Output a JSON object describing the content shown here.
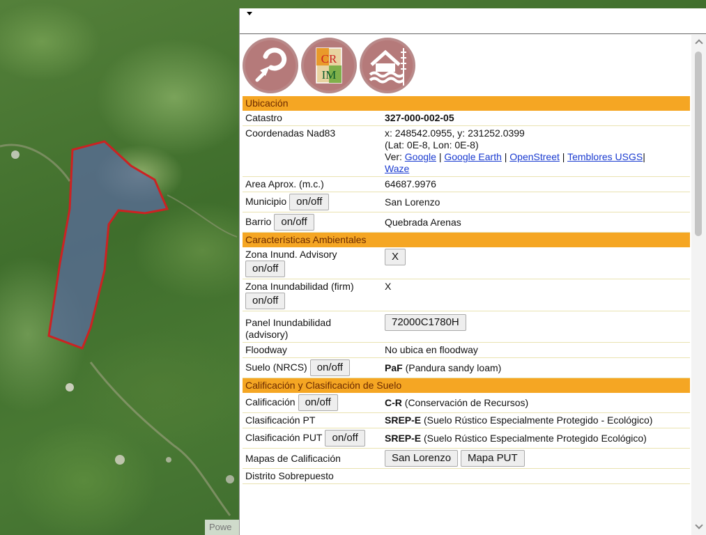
{
  "map": {
    "attribution": "Powe",
    "parcel_outline_color": "#cc2222",
    "parcel_fill_color": "#5a6b9c"
  },
  "logos": [
    {
      "name": "arrow-logo"
    },
    {
      "name": "crim-logo",
      "text_top": "CR",
      "text_bottom": "IM"
    },
    {
      "name": "flood-house-logo"
    }
  ],
  "sections": {
    "ubicacion": "Ubicación",
    "ambientales": "Características Ambientales",
    "calificacion": "Calificación y Clasificación de Suelo"
  },
  "rows": {
    "catastro": {
      "label": "Catastro",
      "value": "327-000-002-05"
    },
    "coords": {
      "label": "Coordenadas Nad83",
      "xy": "x: 248542.0955, y: 231252.0399",
      "latlon": "(Lat: 0E-8, Lon: 0E-8)",
      "ver": "Ver: ",
      "links": [
        "Google",
        "Google Earth",
        "OpenStreet",
        "Temblores USGS",
        "Waze"
      ],
      "sep": " | ",
      "sep_last": "|"
    },
    "area": {
      "label": "Area Aprox. (m.c.)",
      "value": "64687.9976"
    },
    "municipio": {
      "label": "Municipio",
      "value": "San Lorenzo"
    },
    "barrio": {
      "label": "Barrio",
      "value": "Quebrada Arenas"
    },
    "zona_advisory": {
      "label": "Zona Inund. Advisory",
      "value": "X"
    },
    "zona_firm": {
      "label": "Zona Inundabilidad (firm)",
      "value": "X"
    },
    "panel": {
      "label_1": "Panel Inundabilidad",
      "label_2": "(advisory)",
      "value": "72000C1780H"
    },
    "floodway": {
      "label": "Floodway",
      "value": "No ubica en floodway"
    },
    "suelo": {
      "label": "Suelo (NRCS)",
      "code": "PaF",
      "desc": " (Pandura sandy loam)"
    },
    "calificacion": {
      "label": "Calificación",
      "code": "C-R",
      "desc": " (Conservación de Recursos)"
    },
    "clas_pt": {
      "label": "Clasificación PT",
      "code": "SREP-E",
      "desc": " (Suelo Rústico Especialmente Protegido - Ecológico)"
    },
    "clas_put": {
      "label": "Clasificación PUT",
      "code": "SREP-E",
      "desc": " (Suelo Rústico Especialmente Protegido Ecológico)"
    },
    "mapas": {
      "label": "Mapas de Calificación",
      "btn_1": "San Lorenzo",
      "btn_2": "Mapa PUT"
    },
    "distrito": {
      "label": "Distrito Sobrepuesto"
    }
  },
  "toggle_label": "on/off",
  "colors": {
    "section_bg": "#f5a623",
    "section_text": "#6b2a00",
    "link": "#1a3bd0"
  }
}
